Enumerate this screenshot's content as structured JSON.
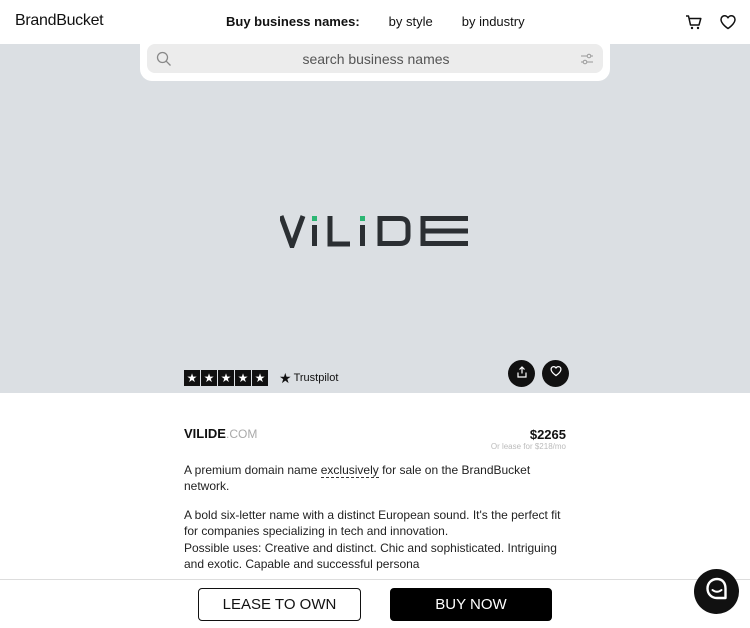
{
  "header": {
    "logo": "BrandBucket",
    "nav_title": "Buy business names:",
    "nav_links": [
      "by style",
      "by industry"
    ],
    "icons": [
      "cart-icon",
      "heart-icon"
    ]
  },
  "search": {
    "placeholder": "search business names"
  },
  "hero": {
    "brand_logo_text": "VILIDE",
    "brand_colors": {
      "dark": "#2b2f33",
      "accent": "#2bb673"
    },
    "trustpilot": {
      "stars": 5,
      "label": "Trustpilot"
    }
  },
  "listing": {
    "name": "VILIDE",
    "tld": ".COM",
    "price": "$2265",
    "lease_note": "Or lease for $218/mo",
    "desc1_before": "A premium domain name ",
    "desc1_link": "exclusively",
    "desc1_after": " for sale on the BrandBucket network.",
    "desc2": "A bold six-letter name with a distinct European sound. It's the perfect fit for companies specializing in tech and innovation.",
    "desc3": "Possible uses: Creative and distinct. Chic and sophisticated. Intriguing and exotic. Capable and successful persona"
  },
  "actions": {
    "lease_label": "LEASE TO OWN",
    "buy_label": "BUY NOW"
  }
}
